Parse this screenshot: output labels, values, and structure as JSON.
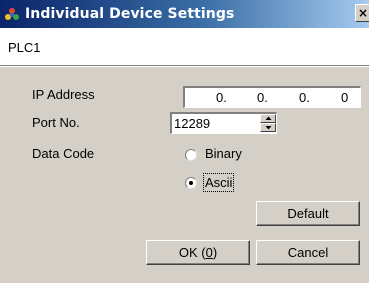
{
  "window": {
    "title": "Individual Device Settings",
    "close_glyph": "×",
    "icon": "device-settings-icon"
  },
  "device_name": "PLC1",
  "ip_address": {
    "label": "IP Address",
    "octets": [
      "0.",
      "0.",
      "0.",
      "0"
    ]
  },
  "port": {
    "label": "Port No.",
    "value": "12289"
  },
  "data_code": {
    "label": "Data Code",
    "options": [
      {
        "label": "Binary",
        "selected": false
      },
      {
        "label": "Ascii",
        "selected": true
      }
    ]
  },
  "buttons": {
    "default_label": "Default",
    "ok_label": "OK (",
    "ok_mnemonic": "0",
    "ok_suffix": ")",
    "cancel_label": "Cancel"
  }
}
